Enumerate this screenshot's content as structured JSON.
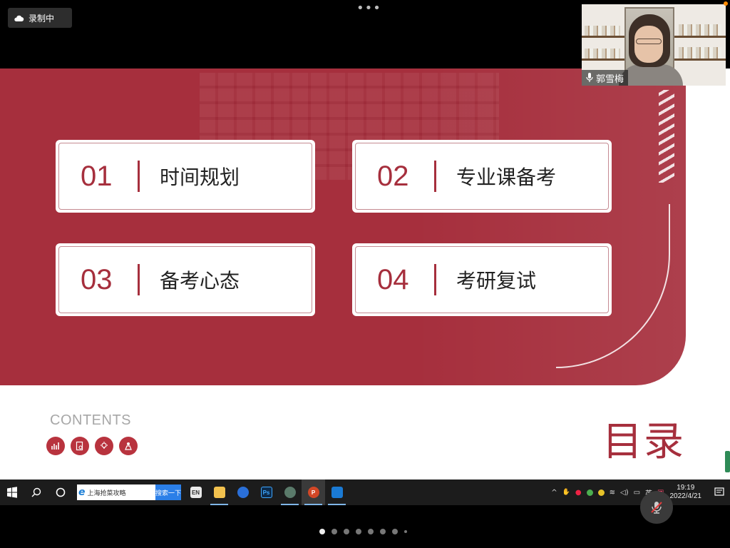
{
  "recording": {
    "label": "录制中"
  },
  "slide": {
    "cards": [
      {
        "num": "01",
        "label": "时间规划"
      },
      {
        "num": "02",
        "label": "专业课备考"
      },
      {
        "num": "03",
        "label": "备考心态"
      },
      {
        "num": "04",
        "label": "考研复试"
      }
    ],
    "contents_label": "CONTENTS",
    "title": "目录",
    "accent_color": "#a62f3d"
  },
  "webcam": {
    "participant_name": "郭雪梅"
  },
  "taskbar": {
    "browser_text": "上海抢菜攻略",
    "search_button": "搜索一下",
    "apps": [
      "EN",
      "file-explorer-icon",
      "sogou-browser-icon",
      "Ps",
      "user-avatar-icon",
      "P",
      "remote-desktop-icon"
    ],
    "ime": "英",
    "time": "19:19",
    "date": "2022/4/21"
  }
}
